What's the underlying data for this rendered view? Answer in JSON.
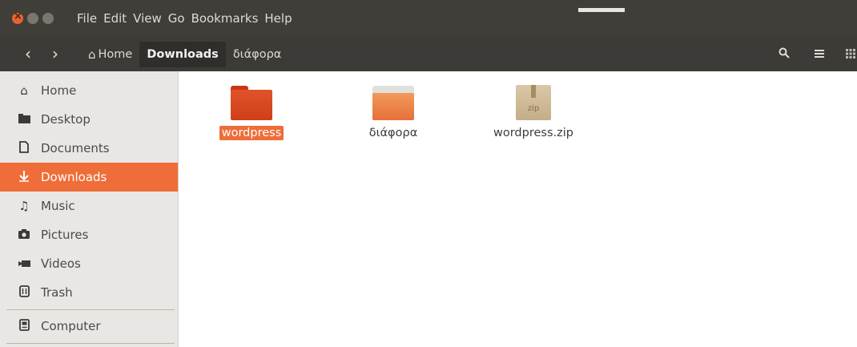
{
  "menubar": {
    "menus": [
      "File",
      "Edit",
      "View",
      "Go",
      "Bookmarks",
      "Help"
    ]
  },
  "toolbar": {
    "back_glyph": "‹",
    "forward_glyph": "›",
    "breadcrumbs": [
      {
        "label": "Home",
        "icon": "home-icon"
      },
      {
        "label": "Downloads"
      },
      {
        "label": "διάφορα"
      }
    ],
    "search_icon": "search-icon",
    "list_view_icon": "list-view-icon",
    "grid_view_icon": "grid-view-icon"
  },
  "sidebar": {
    "items": [
      {
        "label": "Home",
        "icon": "home-icon"
      },
      {
        "label": "Desktop",
        "icon": "desktop-folder-icon"
      },
      {
        "label": "Documents",
        "icon": "document-icon"
      },
      {
        "label": "Downloads",
        "icon": "download-arrow-icon",
        "active": true
      },
      {
        "label": "Music",
        "icon": "music-icon"
      },
      {
        "label": "Pictures",
        "icon": "camera-icon"
      },
      {
        "label": "Videos",
        "icon": "video-camera-icon"
      },
      {
        "label": "Trash",
        "icon": "trash-icon"
      },
      {
        "label": "Computer",
        "icon": "computer-icon"
      }
    ]
  },
  "files": [
    {
      "name": "wordpress",
      "type": "folder",
      "selected": true
    },
    {
      "name": "διάφορα",
      "type": "folder"
    },
    {
      "name": "wordpress.zip",
      "type": "zip",
      "badge": "zip"
    }
  ],
  "colors": {
    "accent": "#ee6d38",
    "titlebar": "#3f3e39",
    "sidebar_bg": "#e8e7e4"
  }
}
